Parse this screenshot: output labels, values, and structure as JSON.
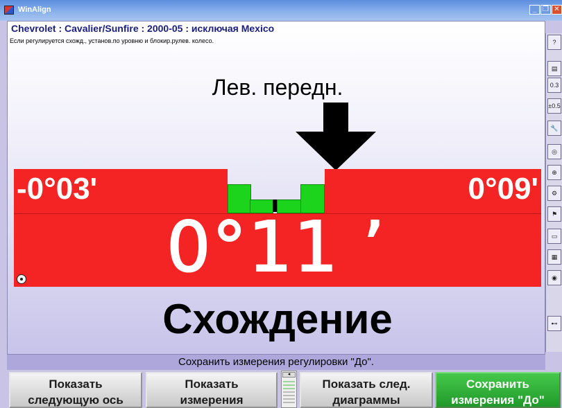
{
  "window": {
    "title": "WinAlign",
    "minimize_label": "_",
    "restore_label": "❐",
    "close_label": "✕"
  },
  "vehicle": {
    "label": "Chevrolet : Cavalier/Sunfire : 2000-05 : исключая Mexico"
  },
  "instruction": "Если регулируется схожд., установ.по уровню и блокир.рулев. колесо.",
  "wheel_label": "Лев. передн.",
  "measurement": {
    "spec_min": "-0°03'",
    "spec_max": "0°09'",
    "value": "0°11 ’",
    "name": "Схождение",
    "status": "out-of-spec",
    "indicator_color": "#f42424",
    "spec_zone_color": "#1cd41c"
  },
  "status_text": "Сохранить измерения регулировки \"До\".",
  "toolbar": {
    "items": [
      {
        "icon": "help-icon",
        "label": "?"
      },
      {
        "icon": "monitor-icon",
        "label": "▤"
      },
      {
        "icon": "spec-values-icon",
        "label": "0.3"
      },
      {
        "icon": "tolerance-icon",
        "label": "±0.5"
      },
      {
        "icon": "wrench-icon",
        "label": "🔧"
      },
      {
        "icon": "tire-icon",
        "label": "◎"
      },
      {
        "icon": "zoom-icon",
        "label": "⊕"
      },
      {
        "icon": "settings-icon",
        "label": "⚙"
      },
      {
        "icon": "flag-icon",
        "label": "⚑"
      },
      {
        "icon": "vehicle-icon",
        "label": "▭"
      },
      {
        "icon": "print-icon",
        "label": "▦"
      },
      {
        "icon": "globe-icon",
        "label": "◉"
      },
      {
        "icon": "axle-icon",
        "label": "⊷"
      }
    ]
  },
  "footer": {
    "buttons": [
      {
        "line1": "Показать",
        "line2": "следующую ось"
      },
      {
        "line1": "Показать",
        "line2": "измерения"
      },
      {
        "line1": "Показать след.",
        "line2": "диаграммы"
      },
      {
        "line1": "Сохранить",
        "line2": "измерения \"До\""
      }
    ]
  }
}
